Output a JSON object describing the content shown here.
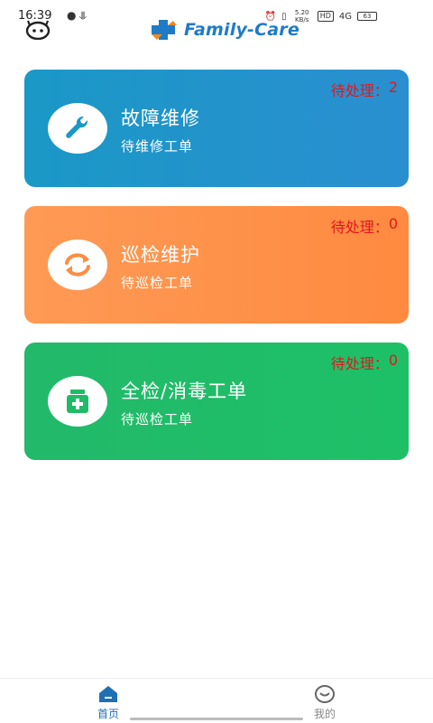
{
  "status_bar": {
    "time": "16:39",
    "left_icons": [
      "chat-bubble-icon",
      "download-icon"
    ],
    "right_items": [
      "alarm-icon",
      "vibrate-icon",
      "5.20 KB/s",
      "HD",
      "4G",
      "63"
    ]
  },
  "header": {
    "brand_name": "Family-Care",
    "back_icon": "back-icon"
  },
  "cards": [
    {
      "title": "故障维修",
      "subtitle": "待维修工单",
      "pending_label": "待处理：",
      "pending_count": "2",
      "icon": "wrench-icon",
      "color": "#1a98c6"
    },
    {
      "title": "巡检维护",
      "subtitle": "待巡检工单",
      "pending_label": "待处理：",
      "pending_count": "0",
      "icon": "refresh-icon",
      "color": "#ff8c42"
    },
    {
      "title": "全检/消毒工单",
      "subtitle": "待巡检工单",
      "pending_label": "待处理：",
      "pending_count": "0",
      "icon": "medicine-bottle-icon",
      "color": "#20bb68"
    }
  ],
  "bottom_nav": {
    "items": [
      {
        "label": "首页",
        "icon": "home-icon",
        "active": true
      },
      {
        "label": "我的",
        "icon": "user-icon",
        "active": false
      }
    ],
    "active_color": "#1f6fb5",
    "inactive_color": "#888888"
  }
}
